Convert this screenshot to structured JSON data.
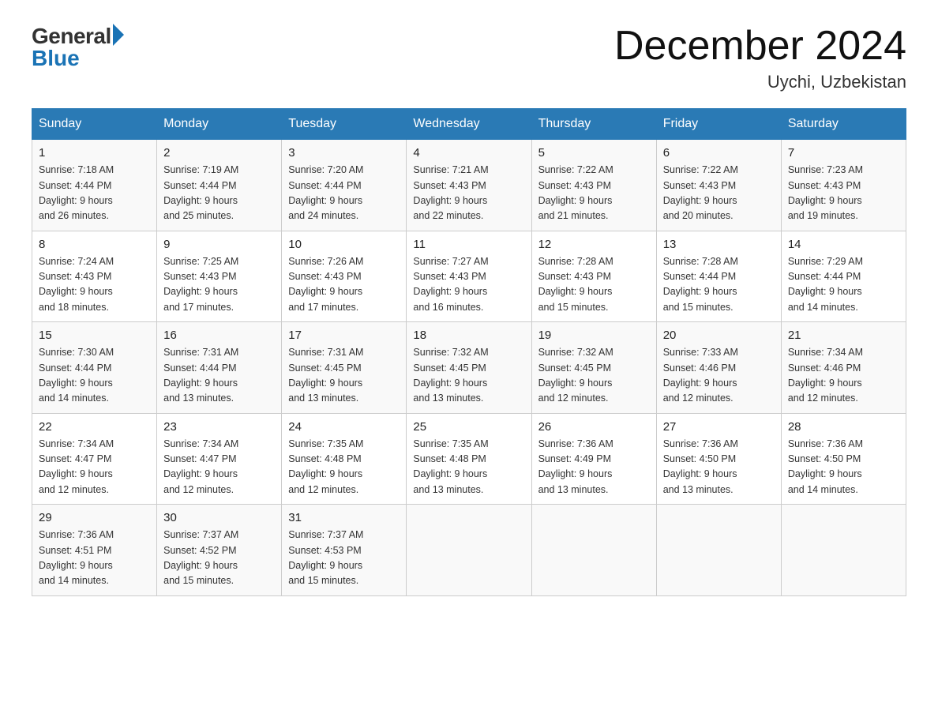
{
  "header": {
    "logo_general": "General",
    "logo_blue": "Blue",
    "month_title": "December 2024",
    "location": "Uychi, Uzbekistan"
  },
  "days_of_week": [
    "Sunday",
    "Monday",
    "Tuesday",
    "Wednesday",
    "Thursday",
    "Friday",
    "Saturday"
  ],
  "weeks": [
    [
      {
        "day": "1",
        "sunrise": "7:18 AM",
        "sunset": "4:44 PM",
        "daylight": "9 hours and 26 minutes."
      },
      {
        "day": "2",
        "sunrise": "7:19 AM",
        "sunset": "4:44 PM",
        "daylight": "9 hours and 25 minutes."
      },
      {
        "day": "3",
        "sunrise": "7:20 AM",
        "sunset": "4:44 PM",
        "daylight": "9 hours and 24 minutes."
      },
      {
        "day": "4",
        "sunrise": "7:21 AM",
        "sunset": "4:43 PM",
        "daylight": "9 hours and 22 minutes."
      },
      {
        "day": "5",
        "sunrise": "7:22 AM",
        "sunset": "4:43 PM",
        "daylight": "9 hours and 21 minutes."
      },
      {
        "day": "6",
        "sunrise": "7:22 AM",
        "sunset": "4:43 PM",
        "daylight": "9 hours and 20 minutes."
      },
      {
        "day": "7",
        "sunrise": "7:23 AM",
        "sunset": "4:43 PM",
        "daylight": "9 hours and 19 minutes."
      }
    ],
    [
      {
        "day": "8",
        "sunrise": "7:24 AM",
        "sunset": "4:43 PM",
        "daylight": "9 hours and 18 minutes."
      },
      {
        "day": "9",
        "sunrise": "7:25 AM",
        "sunset": "4:43 PM",
        "daylight": "9 hours and 17 minutes."
      },
      {
        "day": "10",
        "sunrise": "7:26 AM",
        "sunset": "4:43 PM",
        "daylight": "9 hours and 17 minutes."
      },
      {
        "day": "11",
        "sunrise": "7:27 AM",
        "sunset": "4:43 PM",
        "daylight": "9 hours and 16 minutes."
      },
      {
        "day": "12",
        "sunrise": "7:28 AM",
        "sunset": "4:43 PM",
        "daylight": "9 hours and 15 minutes."
      },
      {
        "day": "13",
        "sunrise": "7:28 AM",
        "sunset": "4:44 PM",
        "daylight": "9 hours and 15 minutes."
      },
      {
        "day": "14",
        "sunrise": "7:29 AM",
        "sunset": "4:44 PM",
        "daylight": "9 hours and 14 minutes."
      }
    ],
    [
      {
        "day": "15",
        "sunrise": "7:30 AM",
        "sunset": "4:44 PM",
        "daylight": "9 hours and 14 minutes."
      },
      {
        "day": "16",
        "sunrise": "7:31 AM",
        "sunset": "4:44 PM",
        "daylight": "9 hours and 13 minutes."
      },
      {
        "day": "17",
        "sunrise": "7:31 AM",
        "sunset": "4:45 PM",
        "daylight": "9 hours and 13 minutes."
      },
      {
        "day": "18",
        "sunrise": "7:32 AM",
        "sunset": "4:45 PM",
        "daylight": "9 hours and 13 minutes."
      },
      {
        "day": "19",
        "sunrise": "7:32 AM",
        "sunset": "4:45 PM",
        "daylight": "9 hours and 12 minutes."
      },
      {
        "day": "20",
        "sunrise": "7:33 AM",
        "sunset": "4:46 PM",
        "daylight": "9 hours and 12 minutes."
      },
      {
        "day": "21",
        "sunrise": "7:34 AM",
        "sunset": "4:46 PM",
        "daylight": "9 hours and 12 minutes."
      }
    ],
    [
      {
        "day": "22",
        "sunrise": "7:34 AM",
        "sunset": "4:47 PM",
        "daylight": "9 hours and 12 minutes."
      },
      {
        "day": "23",
        "sunrise": "7:34 AM",
        "sunset": "4:47 PM",
        "daylight": "9 hours and 12 minutes."
      },
      {
        "day": "24",
        "sunrise": "7:35 AM",
        "sunset": "4:48 PM",
        "daylight": "9 hours and 12 minutes."
      },
      {
        "day": "25",
        "sunrise": "7:35 AM",
        "sunset": "4:48 PM",
        "daylight": "9 hours and 13 minutes."
      },
      {
        "day": "26",
        "sunrise": "7:36 AM",
        "sunset": "4:49 PM",
        "daylight": "9 hours and 13 minutes."
      },
      {
        "day": "27",
        "sunrise": "7:36 AM",
        "sunset": "4:50 PM",
        "daylight": "9 hours and 13 minutes."
      },
      {
        "day": "28",
        "sunrise": "7:36 AM",
        "sunset": "4:50 PM",
        "daylight": "9 hours and 14 minutes."
      }
    ],
    [
      {
        "day": "29",
        "sunrise": "7:36 AM",
        "sunset": "4:51 PM",
        "daylight": "9 hours and 14 minutes."
      },
      {
        "day": "30",
        "sunrise": "7:37 AM",
        "sunset": "4:52 PM",
        "daylight": "9 hours and 15 minutes."
      },
      {
        "day": "31",
        "sunrise": "7:37 AM",
        "sunset": "4:53 PM",
        "daylight": "9 hours and 15 minutes."
      },
      null,
      null,
      null,
      null
    ]
  ],
  "labels": {
    "sunrise_prefix": "Sunrise: ",
    "sunset_prefix": "Sunset: ",
    "daylight_prefix": "Daylight: "
  }
}
